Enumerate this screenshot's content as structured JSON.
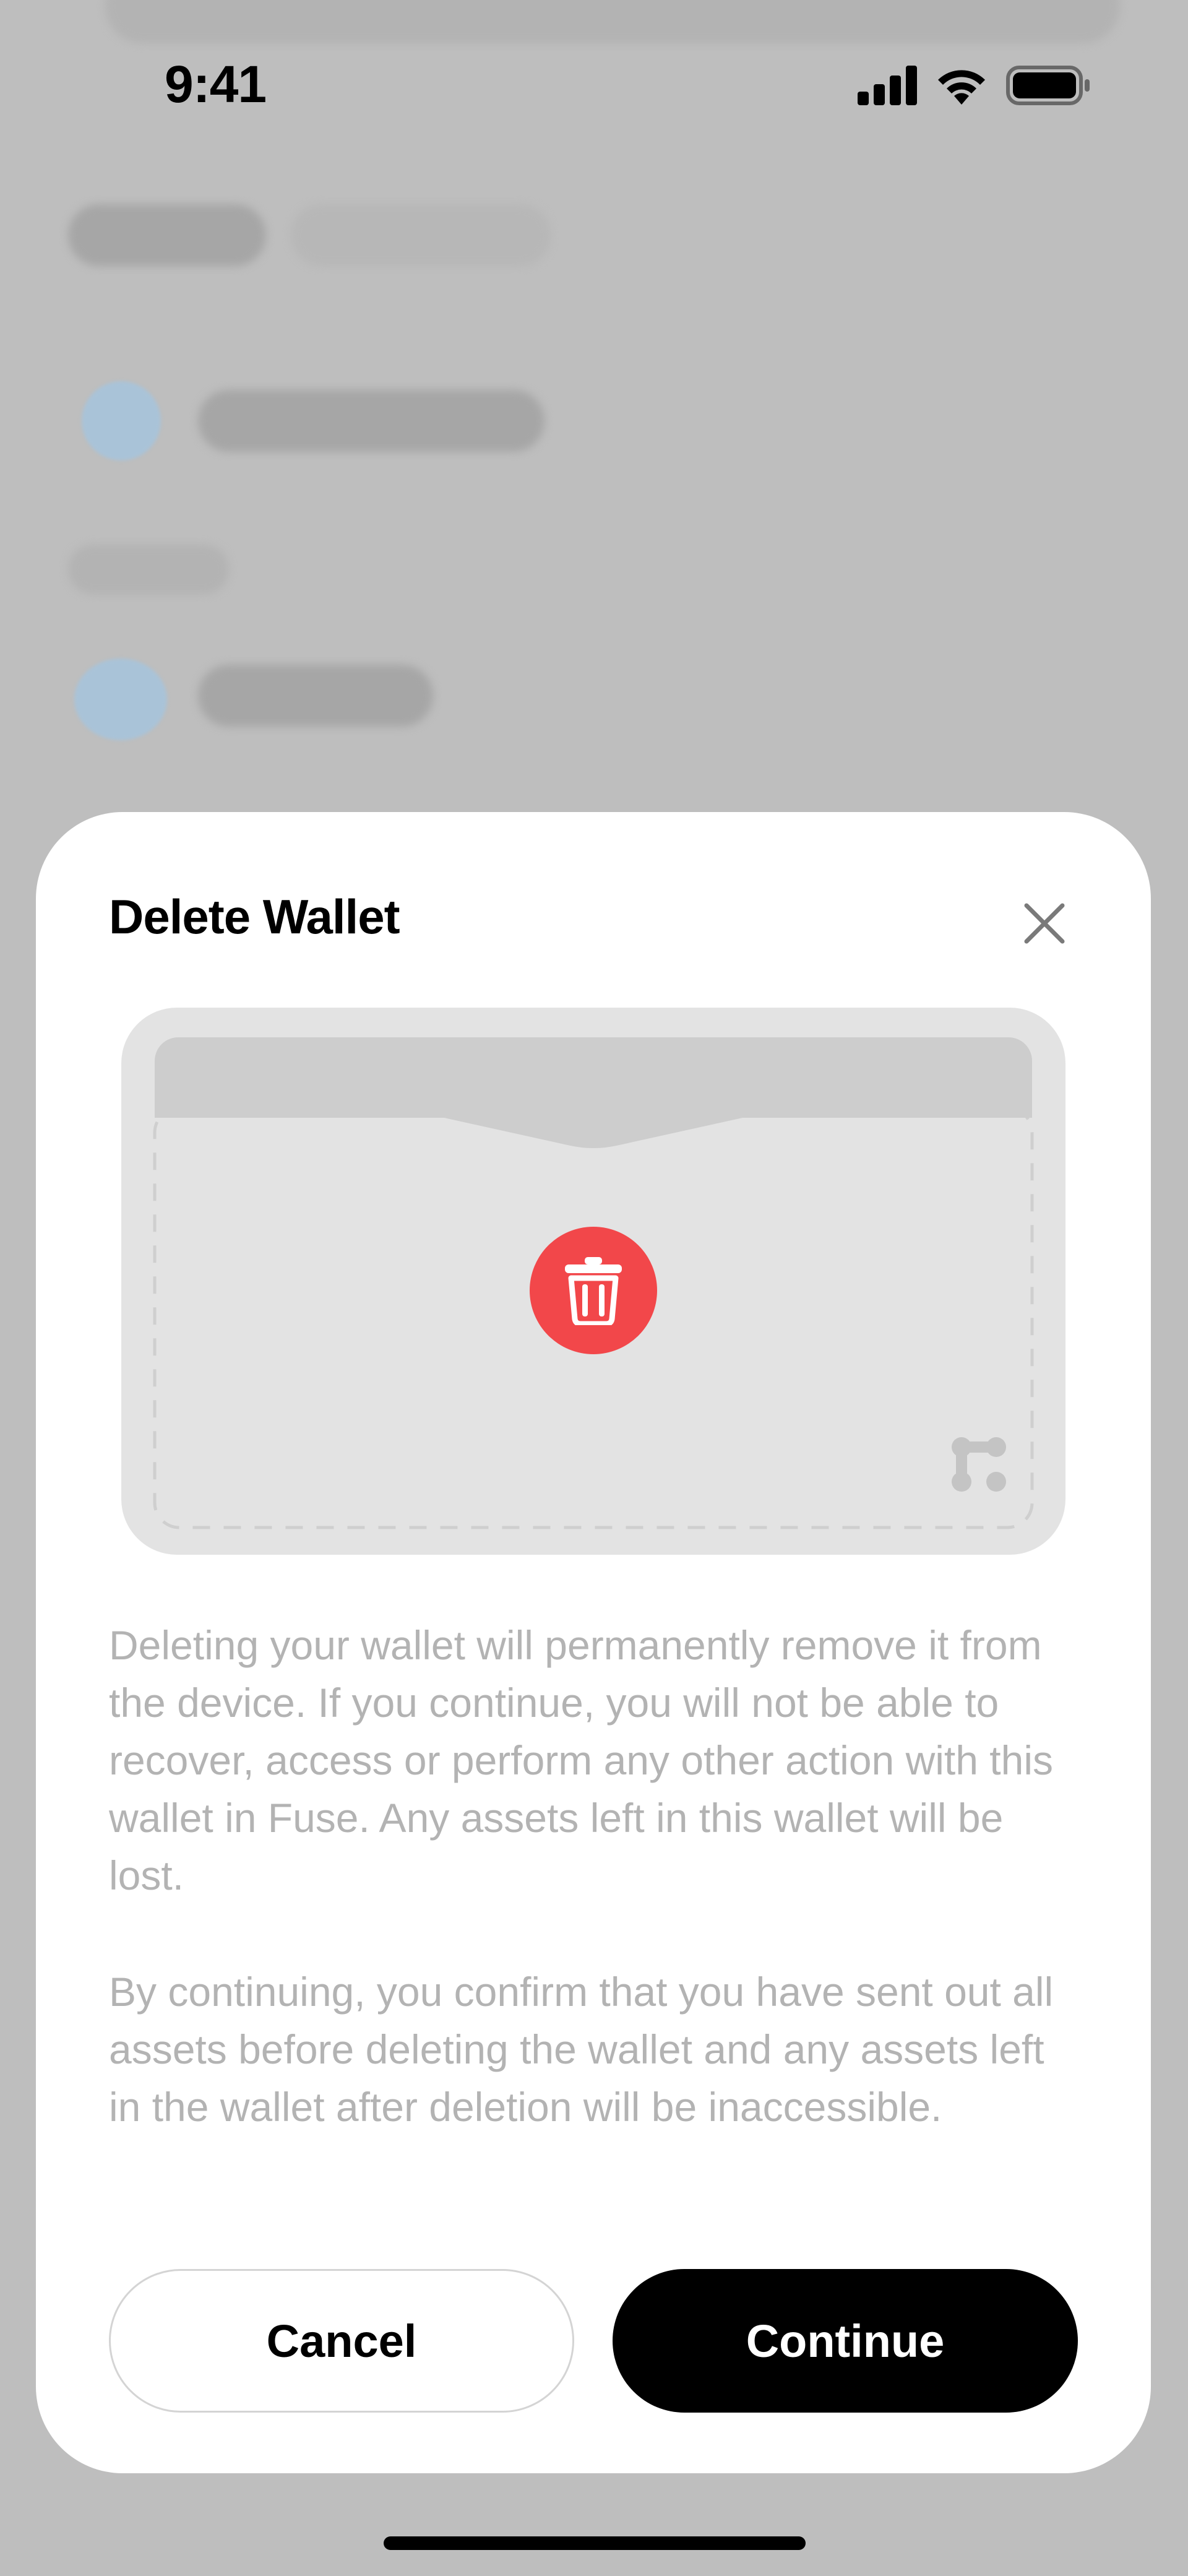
{
  "status_bar": {
    "time": "9:41",
    "icons": [
      "cellular-signal-icon",
      "wifi-icon",
      "battery-icon"
    ]
  },
  "background": {
    "description_hint": "blurred wallet list"
  },
  "sheet": {
    "title": "Delete Wallet",
    "close_icon": "close-icon",
    "illustration_icons": [
      "trash-icon",
      "fuse-logo-icon"
    ],
    "paragraph_1": "Deleting your wallet will permanently remove it from the device. If you continue, you will not be able to recover, access or perform any other action with this wallet in Fuse. Any assets left in this wallet will be lost.",
    "paragraph_2": "By continuing, you confirm that you have sent out all assets before deleting the wallet and any assets left in the wallet after deletion will be inaccessible.",
    "cancel_label": "Cancel",
    "continue_label": "Continue"
  },
  "colors": {
    "backdrop": "#bebebe",
    "sheet": "#ffffff",
    "illustration_bg": "#e3e3e3",
    "danger": "#f2474a",
    "muted_text": "#b3b3b3",
    "primary_button": "#000000"
  }
}
